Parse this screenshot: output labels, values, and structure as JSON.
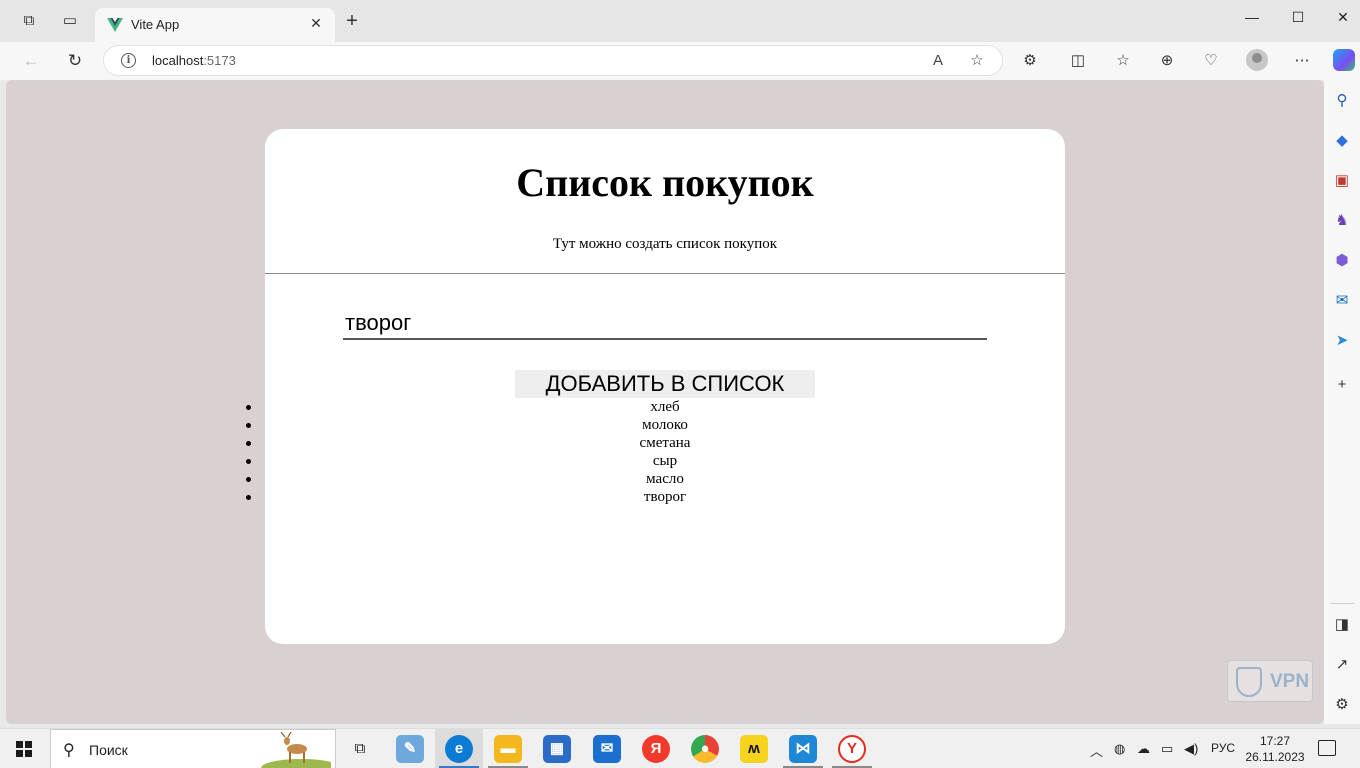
{
  "browser": {
    "tab_title": "Vite App",
    "url_host": "localhost",
    "url_port": ":5173"
  },
  "page": {
    "title": "Список покупок",
    "subtitle": "Тут можно создать список покупок",
    "input_value": "творог",
    "add_button_label": "ДОБАВИТЬ В СПИСОК",
    "items": [
      "хлеб",
      "молоко",
      "сметана",
      "сыр",
      "масло",
      "творог"
    ]
  },
  "overlay": {
    "vpn_label": "VPN"
  },
  "taskbar": {
    "search_label": "Поиск",
    "language": "РУС",
    "time": "17:27",
    "date": "26.11.2023"
  },
  "icons": {
    "accent": "#0078d4",
    "vue_green": "#41b883"
  }
}
